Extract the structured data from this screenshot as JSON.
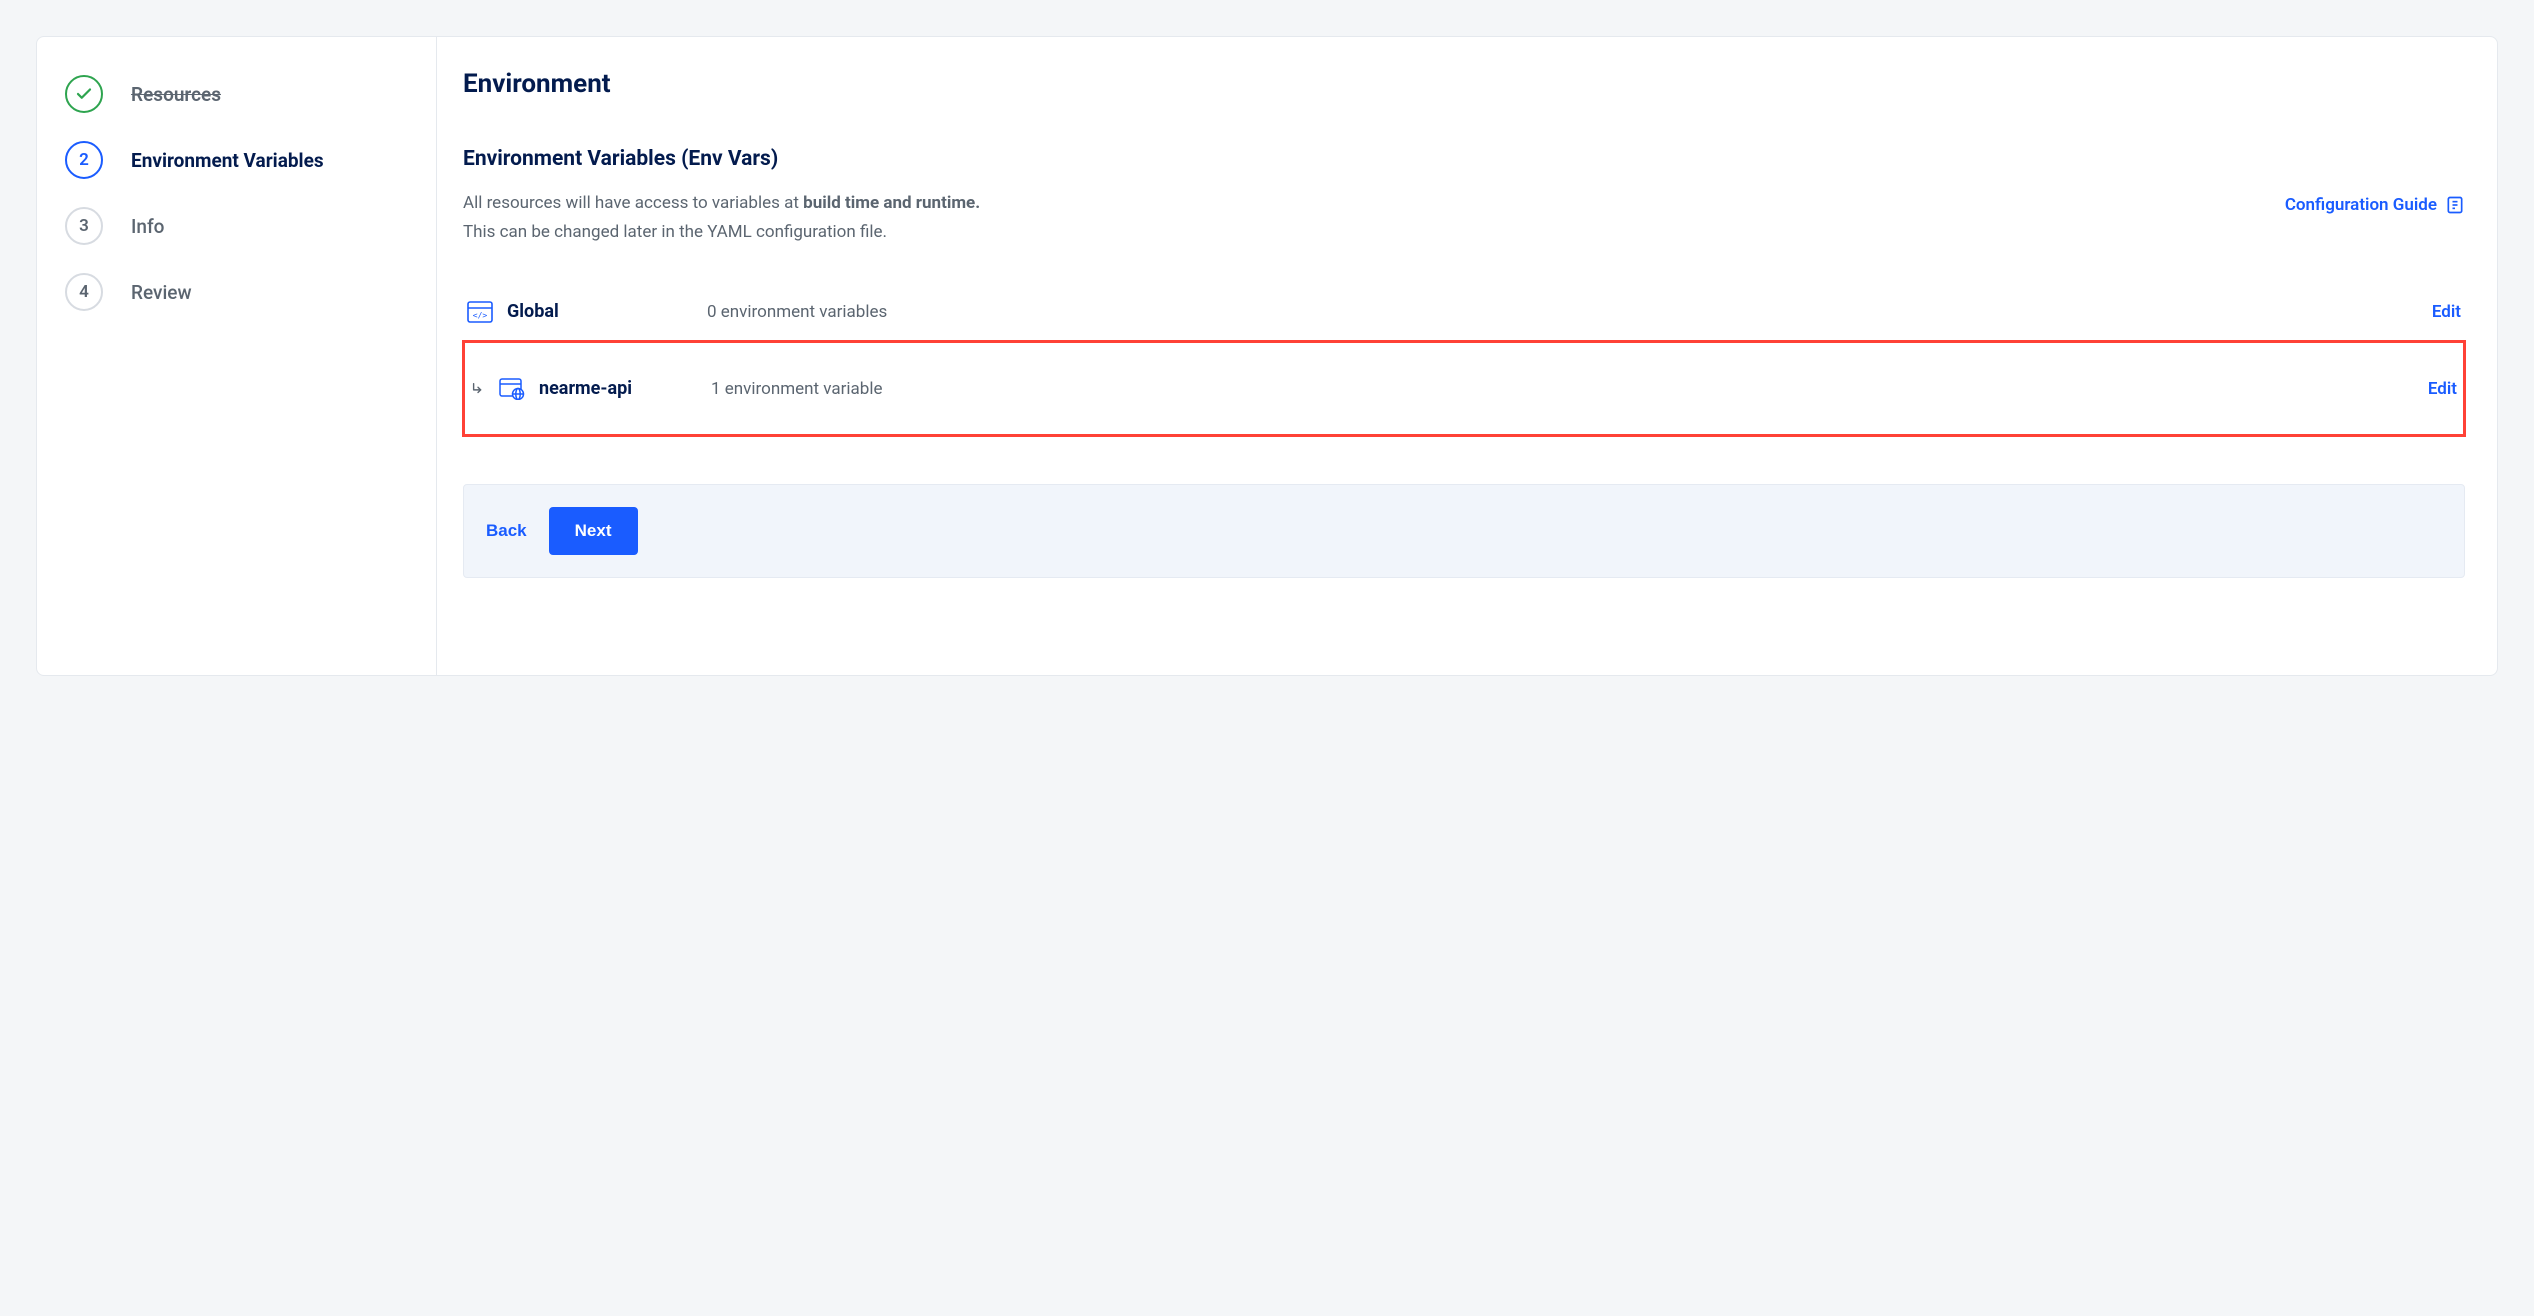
{
  "sidebar": {
    "steps": [
      {
        "label": "Resources",
        "state": "done"
      },
      {
        "label": "Environment Variables",
        "state": "current",
        "number": "2"
      },
      {
        "label": "Info",
        "state": "upcoming",
        "number": "3"
      },
      {
        "label": "Review",
        "state": "upcoming",
        "number": "4"
      }
    ]
  },
  "main": {
    "page_title": "Environment",
    "section_title": "Environment Variables (Env Vars)",
    "desc_line1_a": "All resources will have access to variables at ",
    "desc_line1_b": "build time and runtime.",
    "desc_line2": "This can be changed later in the YAML configuration file.",
    "config_link": "Configuration Guide"
  },
  "env_rows": [
    {
      "name": "Global",
      "count": "0 environment variables",
      "edit": "Edit",
      "type": "global"
    },
    {
      "name": "nearme-api",
      "count": "1 environment variable",
      "edit": "Edit",
      "type": "service",
      "highlighted": true
    }
  ],
  "footer": {
    "back": "Back",
    "next": "Next"
  }
}
